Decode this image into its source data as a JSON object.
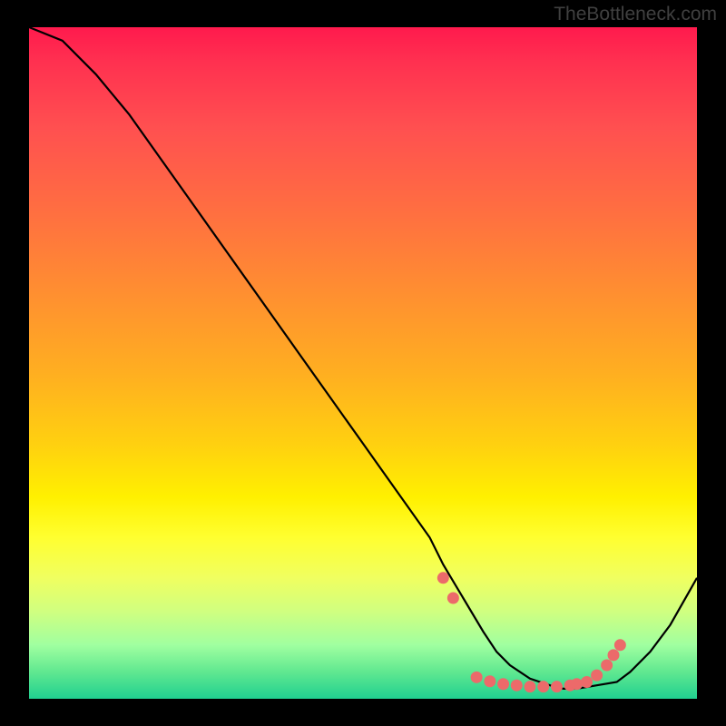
{
  "attribution": "TheBottleneck.com",
  "chart_data": {
    "type": "line",
    "title": "",
    "xlabel": "",
    "ylabel": "",
    "xlim": [
      0,
      100
    ],
    "ylim": [
      0,
      100
    ],
    "series": [
      {
        "name": "curve",
        "x": [
          0,
          5,
          10,
          15,
          20,
          25,
          30,
          35,
          40,
          45,
          50,
          55,
          60,
          62,
          65,
          68,
          70,
          72,
          75,
          78,
          80,
          82,
          85,
          88,
          90,
          93,
          96,
          100
        ],
        "y": [
          100,
          98,
          93,
          87,
          80,
          73,
          66,
          59,
          52,
          45,
          38,
          31,
          24,
          20,
          15,
          10,
          7,
          5,
          3,
          2,
          1.5,
          1.5,
          2,
          2.5,
          4,
          7,
          11,
          18
        ]
      },
      {
        "name": "dots",
        "x": [
          62,
          63.5,
          67,
          69,
          71,
          73,
          75,
          77,
          79,
          81,
          82,
          83.5,
          85,
          86.5,
          87.5,
          88.5
        ],
        "y": [
          18,
          15,
          3.2,
          2.6,
          2.2,
          2.0,
          1.8,
          1.8,
          1.8,
          2.0,
          2.2,
          2.5,
          3.5,
          5.0,
          6.5,
          8.0
        ]
      }
    ],
    "background": {
      "type": "vertical-gradient",
      "stops": [
        {
          "pos": 0,
          "color": "#ff1a4d"
        },
        {
          "pos": 50,
          "color": "#ffb020"
        },
        {
          "pos": 78,
          "color": "#ffff30"
        },
        {
          "pos": 100,
          "color": "#20d090"
        }
      ]
    },
    "dot_color": "#ec6a6a",
    "line_color": "#000000"
  }
}
